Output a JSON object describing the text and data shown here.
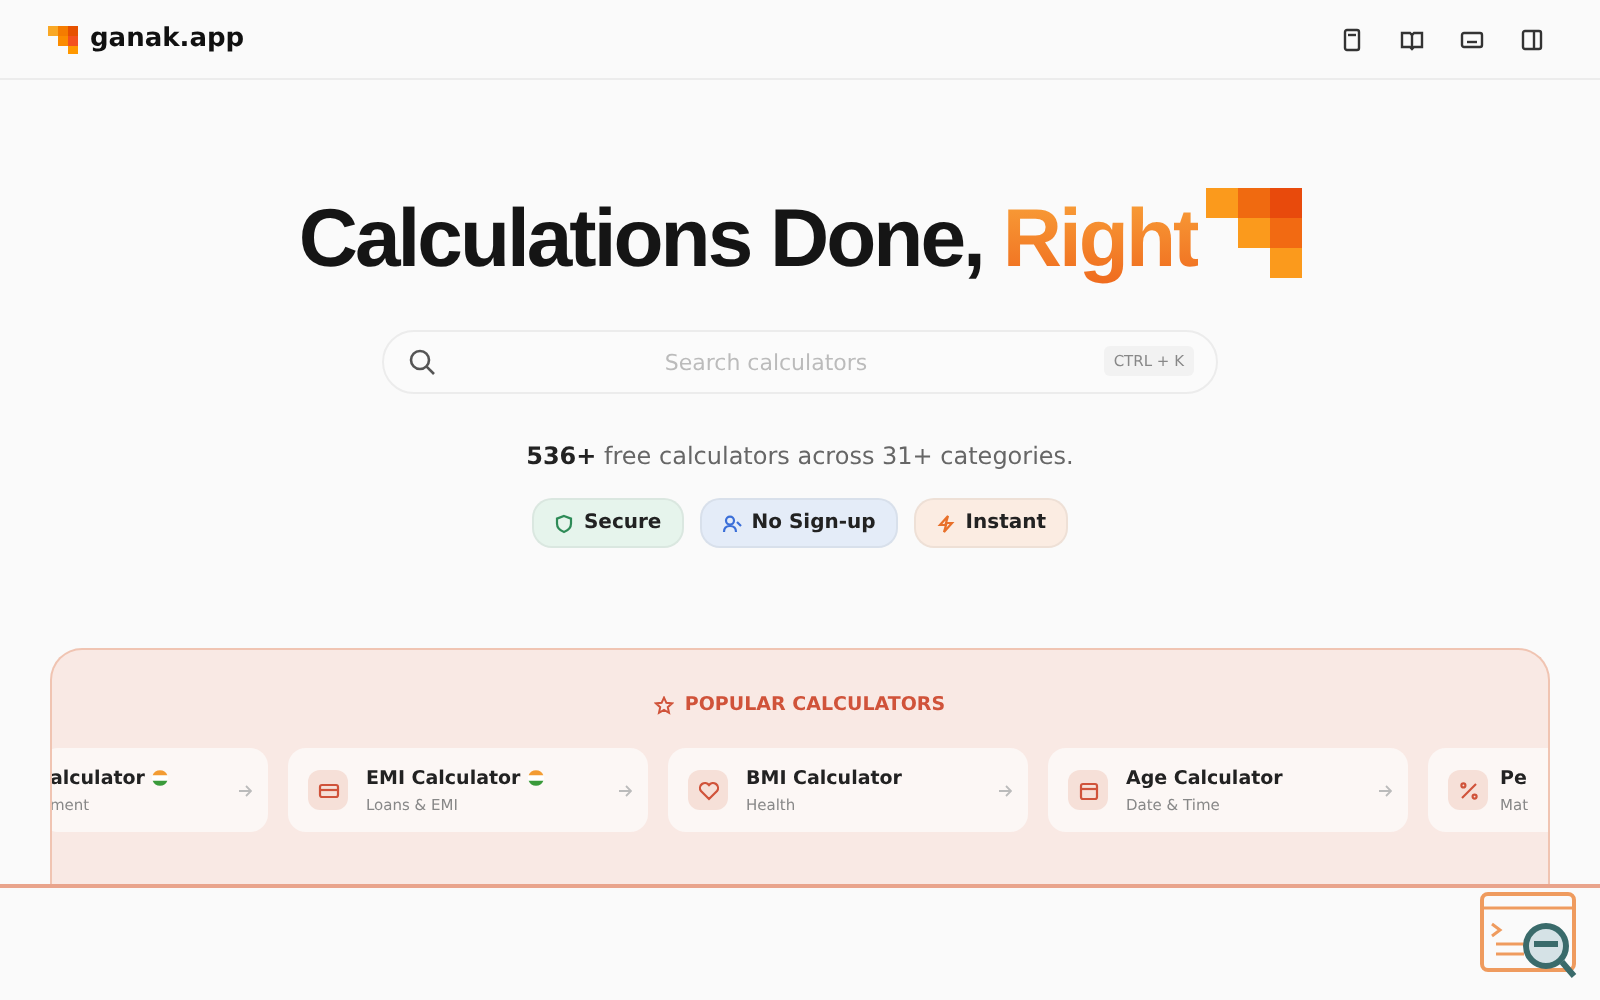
{
  "header": {
    "brand": "ganak.app"
  },
  "hero": {
    "title": "Calculations Done,",
    "title_accent": "Right"
  },
  "search": {
    "placeholder": "Search calculators",
    "shortcut": [
      "CTRL",
      "+",
      "K"
    ]
  },
  "summary": "**536+** free calculators across 31+ categories.",
  "badges": [
    {
      "label": "Secure",
      "kind": "shield",
      "color": "#e6f4ec"
    },
    {
      "label": "No Sign-up",
      "kind": "user",
      "color": "#e4ecf8"
    },
    {
      "label": "Instant",
      "kind": "bolt",
      "color": "#fbece2"
    }
  ],
  "popular": {
    "title": "POPULAR CALCULATORS",
    "cards": [
      {
        "title": "alculator",
        "subtitle": "ment",
        "kind": "clipped",
        "flag": true
      },
      {
        "title": "EMI Calculator",
        "subtitle": "Loans & EMI",
        "kind": "card",
        "flag": true
      },
      {
        "title": "BMI Calculator",
        "subtitle": "Health",
        "kind": "heart",
        "flag": false
      },
      {
        "title": "Age Calculator",
        "subtitle": "Date & Time",
        "kind": "calendar",
        "flag": false
      },
      {
        "title": "Pe",
        "subtitle": "Mat",
        "kind": "percent",
        "flag": false
      }
    ]
  }
}
